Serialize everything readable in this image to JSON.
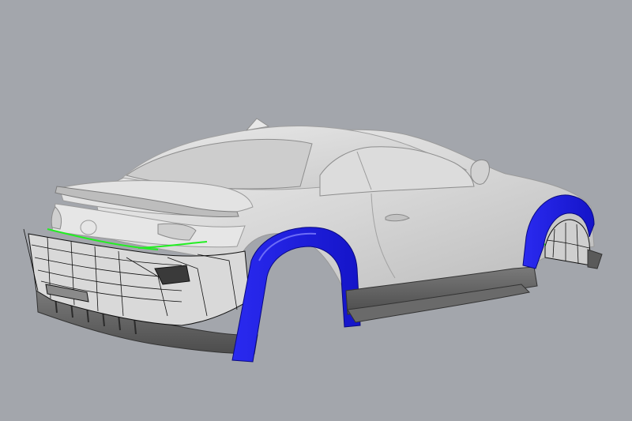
{
  "viewport": {
    "background_color": "#a3a6ac",
    "body_color": "#d7d7d7",
    "dark_trim_color": "#5a5a5a",
    "fender_flare_color": "#1f1fe6",
    "highlight_edge_color": "#22ee22",
    "wireframe_color": "#111111"
  }
}
